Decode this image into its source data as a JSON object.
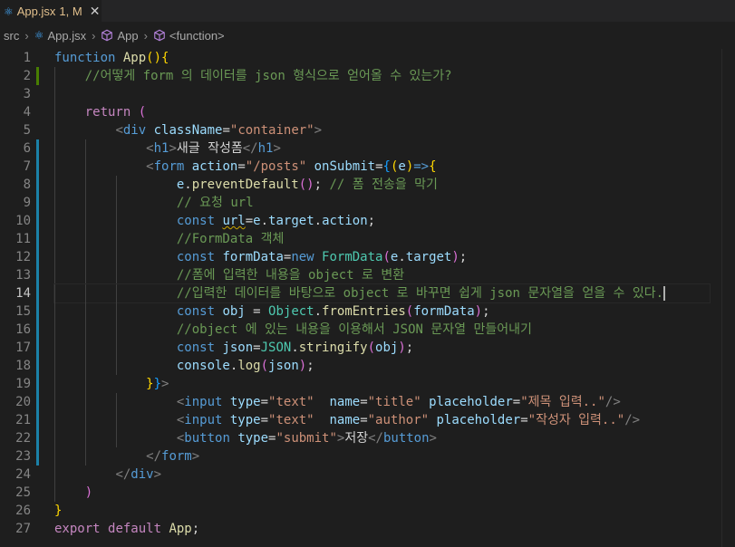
{
  "tab": {
    "icon": "react-icon",
    "label": "App.jsx",
    "status": "1, M"
  },
  "breadcrumb": {
    "items": [
      {
        "label": "src",
        "icon": ""
      },
      {
        "label": "App.jsx",
        "icon": "react-icon"
      },
      {
        "label": "App",
        "icon": "cube-icon"
      },
      {
        "label": "<function>",
        "icon": "cube-icon"
      }
    ]
  },
  "editor": {
    "active_line": 14,
    "line_numbers": [
      "1",
      "2",
      "3",
      "4",
      "5",
      "6",
      "7",
      "8",
      "9",
      "10",
      "11",
      "12",
      "13",
      "14",
      "15",
      "16",
      "17",
      "18",
      "19",
      "20",
      "21",
      "22",
      "23",
      "24",
      "25",
      "26",
      "27"
    ],
    "lines": [
      [
        [
          "kw",
          "function "
        ],
        [
          "fn",
          "App"
        ],
        [
          "p1",
          "(){"
        ]
      ],
      [
        [
          "txt",
          "    "
        ],
        [
          "cmt",
          "//어떻게 form 의 데이터를 json 형식으로 얻어올 수 있는가?"
        ]
      ],
      [],
      [
        [
          "txt",
          "    "
        ],
        [
          "ctl",
          "return "
        ],
        [
          "p2",
          "("
        ]
      ],
      [
        [
          "txt",
          "        "
        ],
        [
          "ang",
          "<"
        ],
        [
          "tag",
          "div "
        ],
        [
          "attr",
          "className"
        ],
        [
          "txt",
          "="
        ],
        [
          "str",
          "\"container\""
        ],
        [
          "ang",
          ">"
        ]
      ],
      [
        [
          "txt",
          "            "
        ],
        [
          "ang",
          "<"
        ],
        [
          "tag",
          "h1"
        ],
        [
          "ang",
          ">"
        ],
        [
          "txt",
          "새글 작성폼"
        ],
        [
          "ang",
          "</"
        ],
        [
          "tag",
          "h1"
        ],
        [
          "ang",
          ">"
        ]
      ],
      [
        [
          "txt",
          "            "
        ],
        [
          "ang",
          "<"
        ],
        [
          "tag",
          "form "
        ],
        [
          "attr",
          "action"
        ],
        [
          "txt",
          "="
        ],
        [
          "str",
          "\"/posts\" "
        ],
        [
          "attr",
          "onSubmit"
        ],
        [
          "txt",
          "="
        ],
        [
          "p3",
          "{"
        ],
        [
          "p1",
          "("
        ],
        [
          "var",
          "e"
        ],
        [
          "p1",
          ")"
        ],
        [
          "kw",
          "=>"
        ],
        [
          "p1",
          "{"
        ]
      ],
      [
        [
          "txt",
          "                "
        ],
        [
          "var",
          "e"
        ],
        [
          "txt",
          "."
        ],
        [
          "fn",
          "preventDefault"
        ],
        [
          "p2",
          "()"
        ],
        [
          "txt",
          "; "
        ],
        [
          "cmt",
          "// 폼 전송을 막기"
        ]
      ],
      [
        [
          "txt",
          "                "
        ],
        [
          "cmt",
          "// 요청 url"
        ]
      ],
      [
        [
          "txt",
          "                "
        ],
        [
          "kw",
          "const "
        ],
        [
          "var squig",
          "url"
        ],
        [
          "txt",
          "="
        ],
        [
          "var",
          "e"
        ],
        [
          "txt",
          "."
        ],
        [
          "var",
          "target"
        ],
        [
          "txt",
          "."
        ],
        [
          "var",
          "action"
        ],
        [
          "txt",
          ";"
        ]
      ],
      [
        [
          "txt",
          "                "
        ],
        [
          "cmt",
          "//FormData 객체"
        ]
      ],
      [
        [
          "txt",
          "                "
        ],
        [
          "kw",
          "const "
        ],
        [
          "var",
          "formData"
        ],
        [
          "txt",
          "="
        ],
        [
          "kw",
          "new "
        ],
        [
          "cls",
          "FormData"
        ],
        [
          "p2",
          "("
        ],
        [
          "var",
          "e"
        ],
        [
          "txt",
          "."
        ],
        [
          "var",
          "target"
        ],
        [
          "p2",
          ")"
        ],
        [
          "txt",
          ";"
        ]
      ],
      [
        [
          "txt",
          "                "
        ],
        [
          "cmt",
          "//폼에 입력한 내용을 object 로 변환"
        ]
      ],
      [
        [
          "txt",
          "                "
        ],
        [
          "cmt",
          "//입력한 데이터를 바탕으로 object 로 바꾸면 쉽게 json 문자열을 얻을 수 있다."
        ]
      ],
      [
        [
          "txt",
          "                "
        ],
        [
          "kw",
          "const "
        ],
        [
          "var",
          "obj"
        ],
        [
          "txt",
          " = "
        ],
        [
          "cls",
          "Object"
        ],
        [
          "txt",
          "."
        ],
        [
          "fn",
          "fromEntries"
        ],
        [
          "p2",
          "("
        ],
        [
          "var",
          "formData"
        ],
        [
          "p2",
          ")"
        ],
        [
          "txt",
          ";"
        ]
      ],
      [
        [
          "txt",
          "                "
        ],
        [
          "cmt",
          "//object 에 있는 내용을 이용해서 JSON 문자열 만들어내기"
        ]
      ],
      [
        [
          "txt",
          "                "
        ],
        [
          "kw",
          "const "
        ],
        [
          "var",
          "json"
        ],
        [
          "txt",
          "="
        ],
        [
          "cls",
          "JSON"
        ],
        [
          "txt",
          "."
        ],
        [
          "fn",
          "stringify"
        ],
        [
          "p2",
          "("
        ],
        [
          "var",
          "obj"
        ],
        [
          "p2",
          ")"
        ],
        [
          "txt",
          ";"
        ]
      ],
      [
        [
          "txt",
          "                "
        ],
        [
          "var",
          "console"
        ],
        [
          "txt",
          "."
        ],
        [
          "fn",
          "log"
        ],
        [
          "p2",
          "("
        ],
        [
          "var",
          "json"
        ],
        [
          "p2",
          ")"
        ],
        [
          "txt",
          ";"
        ]
      ],
      [
        [
          "txt",
          "            "
        ],
        [
          "p1",
          "}"
        ],
        [
          "p3",
          "}"
        ],
        [
          "ang",
          ">"
        ]
      ],
      [
        [
          "txt",
          "                "
        ],
        [
          "ang",
          "<"
        ],
        [
          "tag",
          "input "
        ],
        [
          "attr",
          "type"
        ],
        [
          "txt",
          "="
        ],
        [
          "str",
          "\"text\"  "
        ],
        [
          "attr",
          "name"
        ],
        [
          "txt",
          "="
        ],
        [
          "str",
          "\"title\" "
        ],
        [
          "attr",
          "placeholder"
        ],
        [
          "txt",
          "="
        ],
        [
          "str",
          "\"제목 입력..\""
        ],
        [
          "ang",
          "/>"
        ]
      ],
      [
        [
          "txt",
          "                "
        ],
        [
          "ang",
          "<"
        ],
        [
          "tag",
          "input "
        ],
        [
          "attr",
          "type"
        ],
        [
          "txt",
          "="
        ],
        [
          "str",
          "\"text\"  "
        ],
        [
          "attr",
          "name"
        ],
        [
          "txt",
          "="
        ],
        [
          "str",
          "\"author\" "
        ],
        [
          "attr",
          "placeholder"
        ],
        [
          "txt",
          "="
        ],
        [
          "str",
          "\"작성자 입력..\""
        ],
        [
          "ang",
          "/>"
        ]
      ],
      [
        [
          "txt",
          "                "
        ],
        [
          "ang",
          "<"
        ],
        [
          "tag",
          "button "
        ],
        [
          "attr",
          "type"
        ],
        [
          "txt",
          "="
        ],
        [
          "str",
          "\"submit\""
        ],
        [
          "ang",
          ">"
        ],
        [
          "txt",
          "저장"
        ],
        [
          "ang",
          "</"
        ],
        [
          "tag",
          "button"
        ],
        [
          "ang",
          ">"
        ]
      ],
      [
        [
          "txt",
          "            "
        ],
        [
          "ang",
          "</"
        ],
        [
          "tag",
          "form"
        ],
        [
          "ang",
          ">"
        ]
      ],
      [
        [
          "txt",
          "        "
        ],
        [
          "ang",
          "</"
        ],
        [
          "tag",
          "div"
        ],
        [
          "ang",
          ">"
        ]
      ],
      [
        [
          "txt",
          "    "
        ],
        [
          "p2",
          ")"
        ]
      ],
      [
        [
          "p1",
          "}"
        ]
      ],
      [
        [
          "ctl",
          "export "
        ],
        [
          "ctl",
          "default "
        ],
        [
          "fn",
          "App"
        ],
        [
          "txt",
          ";"
        ]
      ]
    ]
  }
}
